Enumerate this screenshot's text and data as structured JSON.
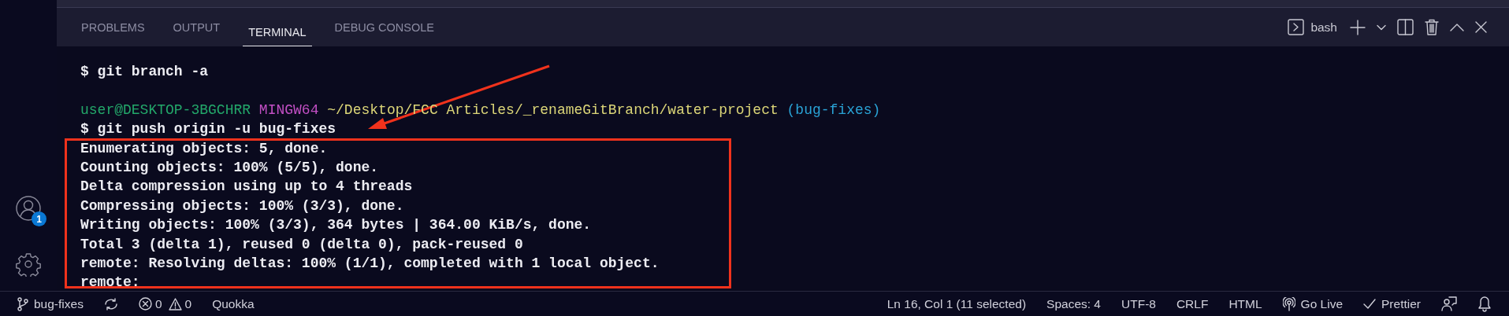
{
  "activity_bar": {
    "items": [
      {
        "kind": "accounts",
        "badge": "1"
      },
      {
        "kind": "settings"
      }
    ]
  },
  "panel": {
    "tabs": [
      {
        "label": "PROBLEMS",
        "selected": false
      },
      {
        "label": "OUTPUT",
        "selected": false
      },
      {
        "label": "TERMINAL",
        "selected": true
      },
      {
        "label": "DEBUG CONSOLE",
        "selected": false
      }
    ],
    "shell": "bash"
  },
  "terminal": {
    "lines": [
      {
        "kind": "command",
        "text": "$ git branch -a"
      },
      {
        "kind": "prompt",
        "segments": [
          {
            "text": "user@DESKTOP-3BGCHRR",
            "color": "#23a86a"
          },
          {
            "text": "MINGW64",
            "color": "#c24fc4"
          },
          {
            "text": "~/Desktop/FCC Articles/_renameGitBranch/water-project",
            "color": "#dcd678"
          },
          {
            "text": "(bug-fixes)",
            "color": "#2aa3d6"
          }
        ]
      },
      {
        "kind": "command",
        "text": "$ git push origin -u bug-fixes"
      },
      {
        "kind": "output",
        "text": "Enumerating objects: 5, done."
      },
      {
        "kind": "output",
        "text": "Counting objects: 100% (5/5), done."
      },
      {
        "kind": "output",
        "text": "Delta compression using up to 4 threads"
      },
      {
        "kind": "output",
        "text": "Compressing objects: 100% (3/3), done."
      },
      {
        "kind": "output",
        "text": "Writing objects: 100% (3/3), 364 bytes | 364.00 KiB/s, done."
      },
      {
        "kind": "output",
        "text": "Total 3 (delta 1), reused 0 (delta 0), pack-reused 0"
      },
      {
        "kind": "output",
        "text": "remote: Resolving deltas: 100% (1/1), completed with 1 local object."
      },
      {
        "kind": "output",
        "text": "remote:"
      }
    ],
    "annotations": {
      "arrow": true,
      "box": true
    }
  },
  "status_bar": {
    "left": [
      {
        "kind": "branch",
        "text": "bug-fixes"
      },
      {
        "kind": "sync"
      },
      {
        "kind": "errors",
        "text": "0"
      },
      {
        "kind": "warnings",
        "text": "0"
      },
      {
        "kind": "text",
        "text": "Quokka"
      }
    ],
    "right": [
      {
        "kind": "text",
        "text": "Ln 16, Col 1 (11 selected)"
      },
      {
        "kind": "text",
        "text": "Spaces: 4"
      },
      {
        "kind": "text",
        "text": "UTF-8"
      },
      {
        "kind": "text",
        "text": "CRLF"
      },
      {
        "kind": "text",
        "text": "HTML"
      },
      {
        "kind": "golive",
        "text": "Go Live"
      },
      {
        "kind": "prettier",
        "text": "Prettier"
      },
      {
        "kind": "feedback"
      },
      {
        "kind": "bell"
      }
    ]
  }
}
